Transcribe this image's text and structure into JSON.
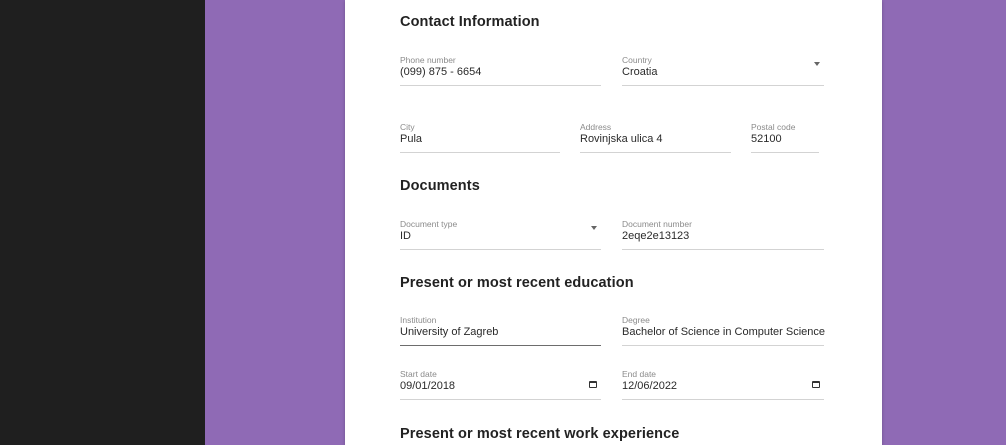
{
  "sections": {
    "contact": "Contact Information",
    "documents": "Documents",
    "education": "Present or most recent education",
    "work": "Present or most recent work experience"
  },
  "contact": {
    "phone": {
      "label": "Phone number",
      "value": "(099) 875 - 6654"
    },
    "country": {
      "label": "Country",
      "value": "Croatia"
    },
    "city": {
      "label": "City",
      "value": "Pula"
    },
    "address": {
      "label": "Address",
      "value": "Rovinjska ulica 4"
    },
    "postal": {
      "label": "Postal code",
      "value": "52100"
    }
  },
  "documents": {
    "type": {
      "label": "Document type",
      "value": "ID"
    },
    "number": {
      "label": "Document number",
      "value": "2eqe2e13123"
    }
  },
  "education": {
    "institution": {
      "label": "Institution",
      "value": "University of Zagreb"
    },
    "degree": {
      "label": "Degree",
      "value": "Bachelor of Science in Computer Science"
    },
    "start": {
      "label": "Start date",
      "value": "09/01/2018"
    },
    "end": {
      "label": "End date",
      "value": "12/06/2022"
    }
  },
  "icons": {
    "dropdown": "chevron-down-icon",
    "calendar": "calendar-icon"
  },
  "colors": {
    "purple": "#8f6ab5",
    "dark": "#1f1f1f"
  }
}
